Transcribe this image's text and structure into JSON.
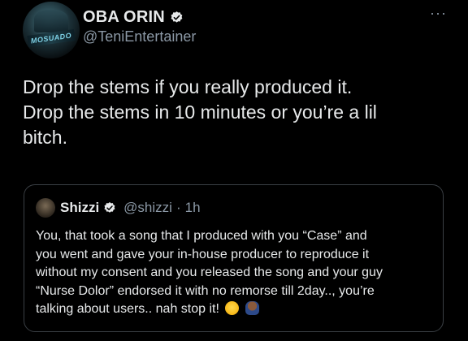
{
  "author": {
    "display_name": "OBA ORIN",
    "handle": "@TeniEntertainer",
    "verified": true,
    "avatar_icon": "avatar-image"
  },
  "more_menu": {
    "label": "···"
  },
  "tweet": {
    "lines": [
      "Drop the stems if you really produced it.",
      "Drop the stems in 10 minutes or you’re a lil",
      "bitch."
    ]
  },
  "quote": {
    "display_name": "Shizzi",
    "handle": "@shizzi",
    "separator": "·",
    "time": "1h",
    "verified": true,
    "lines": [
      "You, that took a song that I produced with you “Case” and",
      "you went and gave your in-house producer to reproduce it",
      "without my consent and you released the song and your guy",
      "“Nurse Dolor” endorsed it with no remorse till 2day.., you’re",
      "talking about users.. nah stop it!"
    ],
    "emojis": [
      "laughing-crying-emoji",
      "person-facepalm-emoji"
    ]
  },
  "colors": {
    "background": "#000000",
    "primary_text": "#e7e9ea",
    "secondary_text": "#8b98a5",
    "border": "#3a3f44",
    "verified_badge": "#e7e9ea"
  }
}
